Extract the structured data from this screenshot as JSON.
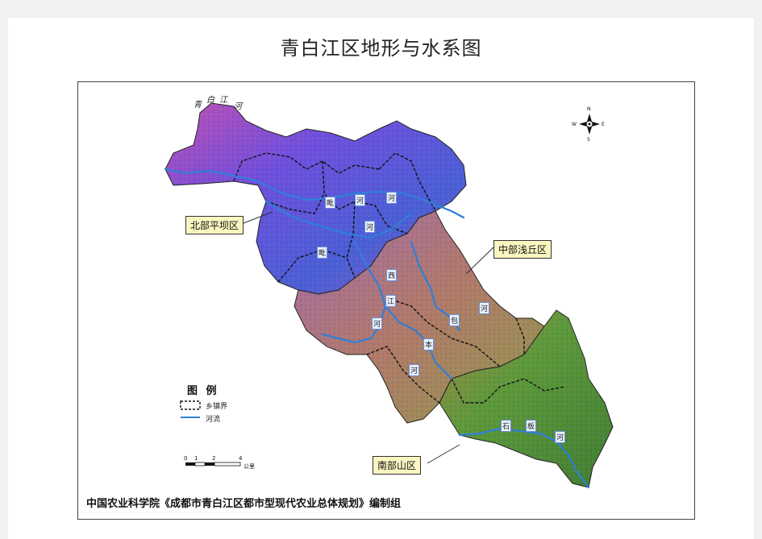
{
  "title": "青白江区地形与水系图",
  "regions": {
    "north": "北部平坝区",
    "central": "中部浅丘区",
    "south": "南部山区"
  },
  "river_top_label": [
    "青",
    "白",
    "江",
    "河"
  ],
  "river_mid_chars": [
    "毗",
    "河",
    "河",
    "河",
    "毗",
    "西",
    "江",
    "河",
    "河",
    "本",
    "包",
    "河"
  ],
  "river_south_chars": [
    "石",
    "板",
    "河"
  ],
  "legend": {
    "title": "图  例",
    "items": [
      {
        "label": "乡镇界",
        "type": "boundary"
      },
      {
        "label": "河流",
        "type": "river"
      }
    ]
  },
  "scale": {
    "ticks": [
      "0",
      "1",
      "2",
      "4"
    ],
    "unit": "公里"
  },
  "compass": {
    "n": "N",
    "s": "S",
    "e": "E",
    "w": "W"
  },
  "footer": "中国农业科学院《成都市青白江区都市型现代农业总体规划》编制组",
  "colors": {
    "north_plain": "#6b4fd6",
    "central_hills": "#b45ea6",
    "south_mountains": "#5f9e3a",
    "river": "#2f7fd9",
    "callout_bg": "#fbf6c0"
  }
}
